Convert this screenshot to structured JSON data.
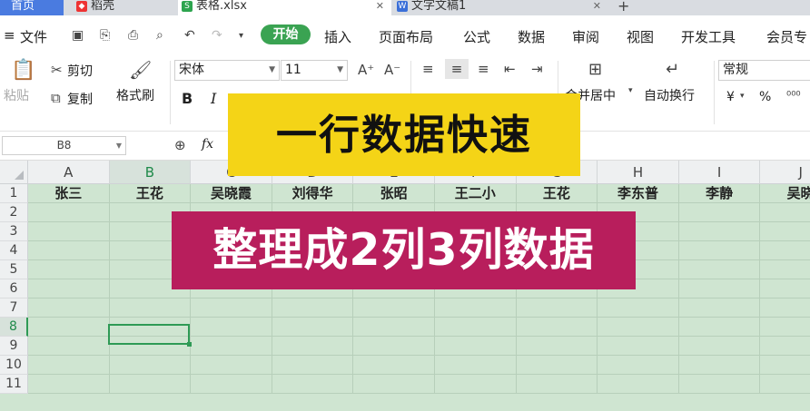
{
  "tabs": {
    "home": "首页",
    "daoke": "稻壳",
    "xlsx": "表格.xlsx",
    "doc": "文字文稿1",
    "add": "+"
  },
  "menu": {
    "file": "文件",
    "start": "开始",
    "insert": "插入",
    "page_layout": "页面布局",
    "formula": "公式",
    "data": "数据",
    "review": "审阅",
    "view": "视图",
    "dev_tools": "开发工具",
    "member": "会员专"
  },
  "ribbon": {
    "paste": "粘贴",
    "cut": "剪切",
    "copy": "复制",
    "format_painter": "格式刷",
    "font_name": "宋体",
    "font_size": "11",
    "bold": "B",
    "italic": "I",
    "merge_center": "合并居中",
    "auto_wrap": "自动换行",
    "number_format": "常规",
    "currency": "¥",
    "percent": "%"
  },
  "formula_bar": {
    "name_box": "B8",
    "fx": "fx"
  },
  "sheet": {
    "columns": [
      "A",
      "B",
      "C",
      "D",
      "E",
      "F",
      "G",
      "H",
      "I",
      "J"
    ],
    "rows": [
      "1",
      "2",
      "3",
      "4",
      "5",
      "6",
      "7",
      "8",
      "9",
      "10",
      "11"
    ],
    "row1": [
      "张三",
      "王花",
      "吴晓霞",
      "刘得华",
      "张昭",
      "王二小",
      "王花",
      "李东普",
      "李静",
      "吴晓"
    ],
    "selected_cell": "B8"
  },
  "overlay": {
    "title": "一行数据快速",
    "subtitle": "整理成2列3列数据"
  },
  "colors": {
    "brand_green": "#3aa352",
    "banner_yellow": "#f4d417",
    "banner_magenta": "#b81e5c",
    "grid_green": "#cfe5d1"
  }
}
